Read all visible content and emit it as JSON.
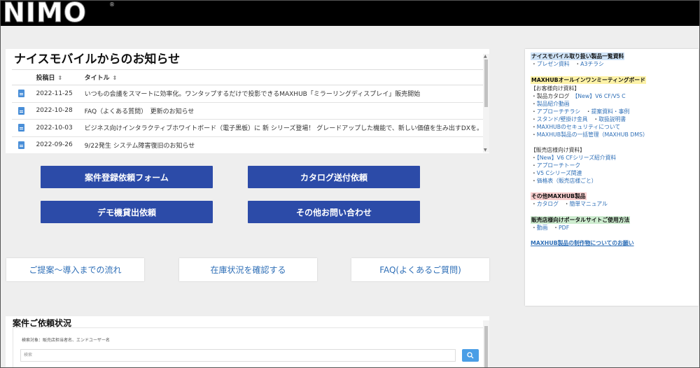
{
  "brand": {
    "logo": "NIMO",
    "reg": "®"
  },
  "news": {
    "title": "ナイスモバイルからのお知らせ",
    "headers": {
      "date": "投稿日",
      "title": "タイトル",
      "sort": "⇕"
    },
    "rows": [
      {
        "date": "2022-11-25",
        "title": "いつもの会議をスマートに効率化。ワンタップするだけで投影できるMAXHUB「ミラーリングディスプレイ」販売開始"
      },
      {
        "date": "2022-10-28",
        "title": "FAQ（よくある質問）　更新のお知らせ"
      },
      {
        "date": "2022-10-03",
        "title": "ビジネス向けインタラクティブホワイトボード（電子黒板）に 新 シリーズ登場！ グレードアップした機能で、新しい価値を生み出すDXを。"
      },
      {
        "date": "2022-09-26",
        "title": "9/22発生 システム障害復旧のお知らせ"
      }
    ]
  },
  "blue_buttons": {
    "case_form": "案件登録依頼フォーム",
    "catalog": "カタログ送付依頼",
    "demo": "デモ機貸出依頼",
    "contact": "その他お問い合わせ"
  },
  "white_buttons": {
    "flow": "ご提案～導入までの流れ",
    "stock": "在庫状況を確認する",
    "faq": "FAQ(よくあるご質問)"
  },
  "status": {
    "title": "案件ご依頼状況",
    "search_label": "検索対象：販売店担当者名、エンドユーザー名",
    "search_placeholder": "検索"
  },
  "sidebar": {
    "s1": {
      "title": "ナイスモバイル取り扱い製品一覧資料",
      "links": [
        "プレゼン資料",
        "A3チラシ"
      ]
    },
    "s2": {
      "title": "MAXHUBオールインワンミーティングボード",
      "sub1": "【お客様向け資料】",
      "product_catalog": "製品カタログ",
      "new_catalog": "【New】V6 CF/V5 C",
      "video": "製品紹介動画",
      "approach_flyer": "アプローチチラシ",
      "proposal": "提案資料・事例",
      "stand": "スタンド/壁掛け金具",
      "manual": "取扱説明書",
      "security": "MAXHUBのセキュリティについて",
      "dms": "MAXHUB製品の一括管理（MAXHUB DMS）",
      "sub2": "【販売店様向け資料】",
      "new_cf": "【New】V6 CFシリーズ紹介資料",
      "approach_talk": "アプローチトーク",
      "v5c": "V5 Cシリーズ関連",
      "price": "価格表（販売店様ごと）"
    },
    "s3": {
      "title": "その他MAXHUB製品",
      "links": [
        "カタログ",
        "簡単マニュアル"
      ]
    },
    "s4": {
      "title": "販売店様向けポータルサイトご使用方法",
      "links": [
        "動画",
        "PDF"
      ]
    },
    "request": "MAXHUB製品の制作物についてのお願い"
  },
  "colors": {
    "primary_button": "#2c4ba8",
    "link": "#2f6fb7",
    "header": "#000000"
  }
}
